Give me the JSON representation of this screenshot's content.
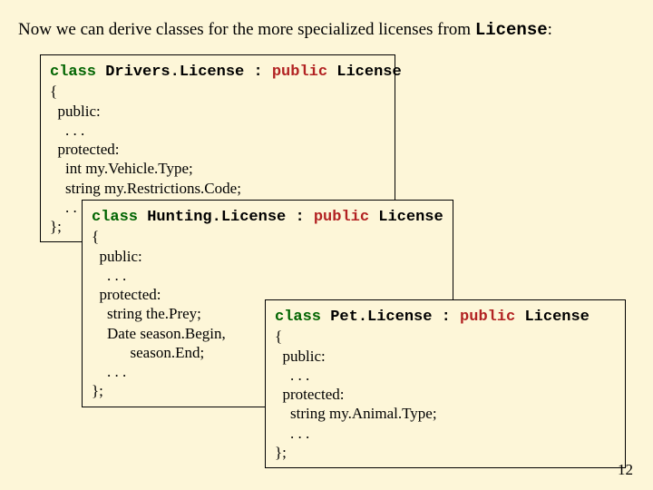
{
  "intro": {
    "pre": "Now we can derive classes for the more specialized licenses from ",
    "mono": "License",
    "post": ":"
  },
  "box1": {
    "l1a": "class",
    "l1b": " Drivers.License : ",
    "l1c": "public",
    "l1d": " License",
    "l2": "{",
    "l3": "  public:",
    "l4": "    . . .",
    "l5": "  protected:",
    "l6": "    int my.Vehicle.Type;",
    "l7": "    string my.Restrictions.Code;",
    "l8": "    . . .",
    "l9": "};"
  },
  "box2": {
    "l1a": "class",
    "l1b": " Hunting.License : ",
    "l1c": "public",
    "l1d": " License",
    "l2": "{",
    "l3": "  public:",
    "l4": "    . . .",
    "l5": "  protected:",
    "l6": "    string the.Prey;",
    "l7": "    Date season.Begin,",
    "l8": "          season.End;",
    "l9": "    . . .",
    "l10": "};"
  },
  "box3": {
    "l1a": "class",
    "l1b": " Pet.License : ",
    "l1c": "public",
    "l1d": " License",
    "l2": "{",
    "l3": "  public:",
    "l4": "    . . .",
    "l5": "  protected:",
    "l6": "    string my.Animal.Type;",
    "l7": "    . . .",
    "l8": "};"
  },
  "pagenum": "12"
}
